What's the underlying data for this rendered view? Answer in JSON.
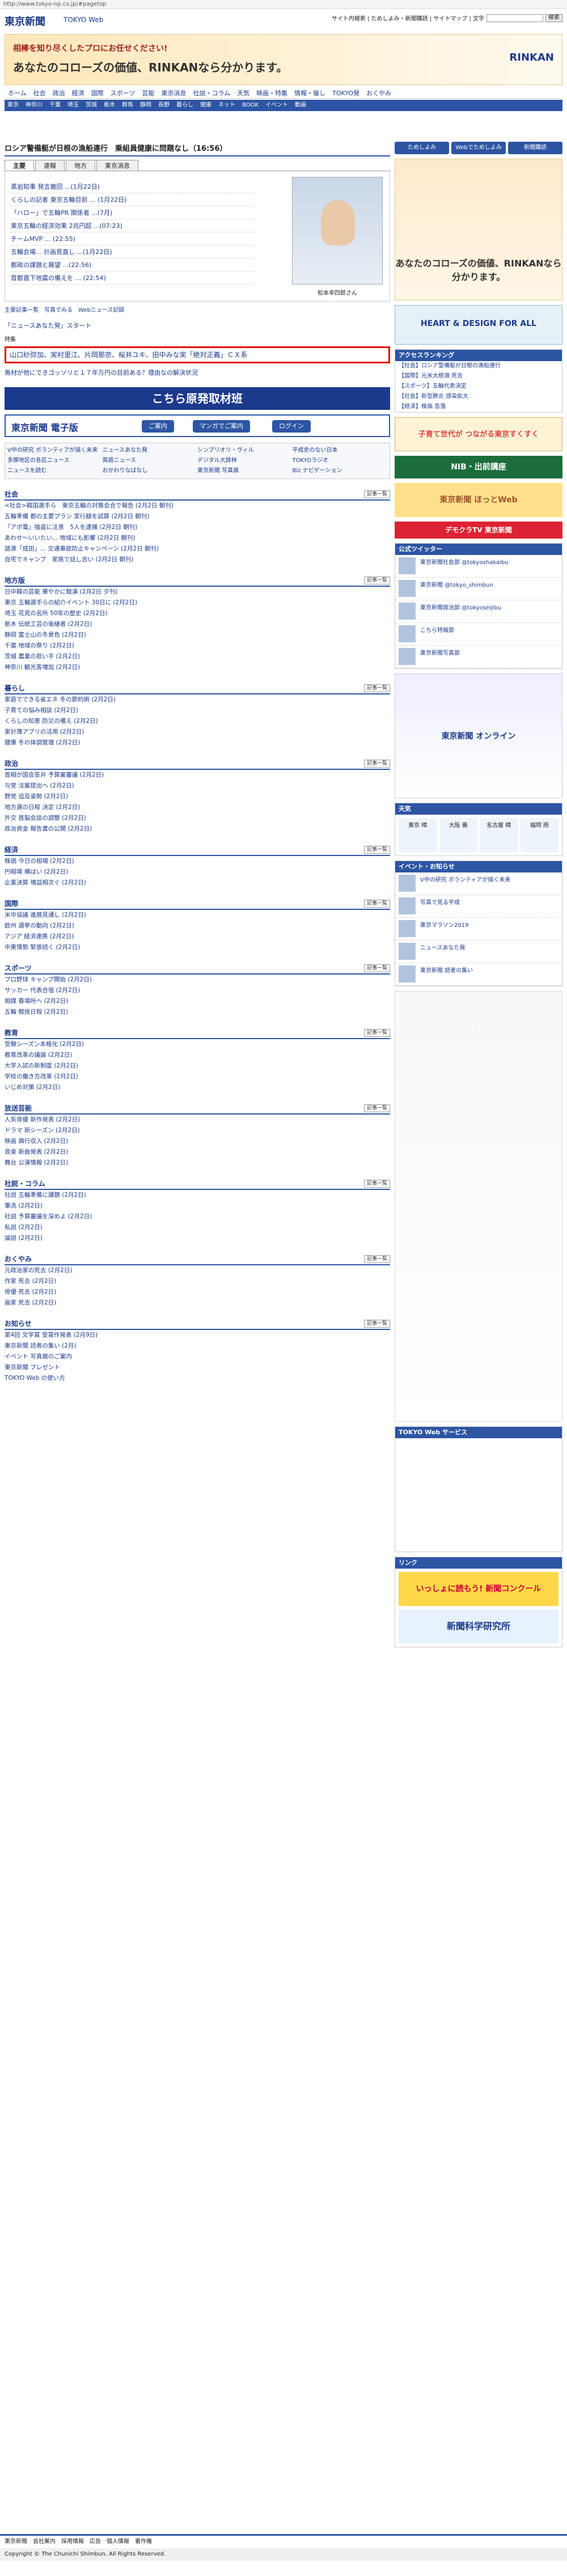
{
  "url": "http://www.tokyo-np.co.jp/#pagetop",
  "logo": {
    "name": "東京新聞",
    "sub": "TOKYO Web"
  },
  "util": {
    "links": "サイト内検索 | ためしよみ・新聞購読 | サイトマップ | 文字",
    "search_btn": "検索"
  },
  "banner_top": {
    "line1": "相棒を知り尽くしたプロにお任せください!",
    "line2": "あなたのコローズの価値、RINKANなら分かります。",
    "brand": "RINKAN"
  },
  "nav1": [
    "ホーム",
    "社会",
    "政治",
    "経済",
    "国際",
    "スポーツ",
    "芸能",
    "東京消息",
    "社説・コラム",
    "天気",
    "映画・特集",
    "情報・催し",
    "TOKYO発",
    "おくやみ"
  ],
  "nav2": [
    "東京",
    "神奈川",
    "千葉",
    "埼玉",
    "茨城",
    "栃木",
    "群馬",
    "静岡",
    "長野",
    "暮らし",
    "健康",
    "ネット",
    "BOOK",
    "イベント",
    "動画"
  ],
  "headline": "ロシア警備艇が日根の漁船連行　乗組員健康に問題なし（16:56）",
  "tabs": [
    "主要",
    "速報",
    "地方",
    "東京消息"
  ],
  "toplist": [
    "黒岩知事 発言撤回 ...(1月22日)",
    "くらしの記者 東京五輪目前 ... (1月22日)",
    "「ハロー」で五輪PR 関係者 ...(7月)",
    "東京五輪の経済効果 2兆円超 ...(07:23)",
    "チームMVP ... (22:55)",
    "五輪会場... 計画見直し ...(1月22日)",
    "都政の課題と展望 ...(22:56)",
    "首都直下地震の備えを ... (22:54)"
  ],
  "photo_caption": "松本幸四郎さん",
  "morelinks": "主要記事一覧　写真でみる　Webニュース記録",
  "recent_label": "特集",
  "sublist": [
    "「ニュースあなた発」スタート"
  ],
  "red_item": "山口紗弥加、実村里江、片岡那奈、桜井ユキ、田中みな実「絶対正義」ＣＸ系",
  "sublist2": [
    "角材が他にできゴッソリと１７年万円の目前ある？理由なの解決状況"
  ],
  "ad_origin": "こちら原発取材班",
  "ad_digital": {
    "title": "東京新聞 電子版",
    "b1": "ご案内",
    "b2": "マンガでご案内",
    "b3": "ログイン"
  },
  "quick": [
    "V中の研究 ボランティアが描く未来",
    "ニュースあなた発",
    "シンプリオリ・ヴィル",
    "平成史のない日本",
    "多摩地区の各区ニュース",
    "英語ニュース",
    "デジタル大辞林",
    "TOKYOラジオ",
    "ニュースを読む",
    "おかわりなばなし",
    "東京新聞 写真展",
    "Biz ナビゲーション"
  ],
  "sections": [
    {
      "title": "社会",
      "items": [
        "<社会>韓国選手ら　東京五輪の対策会合で報告 (2月2日 朝刊)",
        "五輪準備 都の主要プラン 実行額を試算 (2月2日 朝刊)",
        "「アポ電」強盗に注意　5人を逮捕 (2月2日 朝刊)",
        "あわせ〜いいたい... 地域にも影響 (2月2日 朝刊)",
        "語源「成田」... 交通事故防止キャンペーン (2月2日 朝刊)",
        "自宅でキャンプ　家族で話し合い (2月2日 朝刊)"
      ]
    },
    {
      "title": "地方版",
      "items": [
        "日中韓の芸能 華やかに競演 (2月2日 夕刊)",
        "東京 五輪選手らの紹介イベント 30日に (2月2日)",
        "埼玉 花見の名所 50年の歴史 (2月2日)",
        "栃木 伝統工芸の後継者 (2月2日)",
        "静岡 富士山の冬景色 (2月2日)",
        "千葉 地域の祭り (2月2日)",
        "茨城 農業の担い手 (2月2日)",
        "神奈川 観光客増加 (2月2日)"
      ]
    },
    {
      "title": "暮らし",
      "items": [
        "家庭でできる省エネ 冬の節約術 (2月2日)",
        "子育ての悩み相談 (2月2日)",
        "くらしの知恵 防災の備え (2月2日)",
        "家計簿アプリの活用 (2月2日)",
        "健康 冬の体調管理 (2月2日)"
      ]
    },
    {
      "title": "政治",
      "items": [
        "首相が国会答弁 予算案審議 (2月2日)",
        "与党 法案提出へ (2月2日)",
        "野党 追及姿勢 (2月2日)",
        "地方選の日程 決定 (2月2日)",
        "外交 首脳会談の調整 (2月2日)",
        "政治資金 報告書の公開 (2月2日)"
      ]
    },
    {
      "title": "経済",
      "items": [
        "株価 今日の相場 (2月2日)",
        "円相場 横ばい (2月2日)",
        "企業決算 増益相次ぐ (2月2日)"
      ]
    },
    {
      "title": "国際",
      "items": [
        "米中協議 進展見通し (2月2日)",
        "欧州 選挙の動向 (2月2日)",
        "アジア 経済連携 (2月2日)",
        "中東情勢 緊張続く (2月2日)"
      ]
    },
    {
      "title": "スポーツ",
      "items": [
        "プロ野球 キャンプ開始 (2月2日)",
        "サッカー 代表合宿 (2月2日)",
        "相撲 春場所へ (2月2日)",
        "五輪 競技日程 (2月2日)"
      ]
    },
    {
      "title": "教育",
      "items": [
        "受験シーズン本格化 (2月2日)",
        "教育改革の議論 (2月2日)",
        "大学入試の新制度 (2月2日)",
        "学校の働き方改革 (2月2日)",
        "いじめ対策 (2月2日)"
      ]
    },
    {
      "title": "放送芸能",
      "items": [
        "人気俳優 新作発表 (2月2日)",
        "ドラマ 新シーズン (2月2日)",
        "映画 興行収入 (2月2日)",
        "音楽 新曲発表 (2月2日)",
        "舞台 公演情報 (2月2日)"
      ]
    },
    {
      "title": "社説・コラム",
      "items": [
        "社説 五輪準備に課題 (2月2日)",
        "筆洗 (2月2日)",
        "社説 予算審議を深めよ (2月2日)",
        "私説 (2月2日)",
        "論説 (2月2日)"
      ]
    },
    {
      "title": "おくやみ",
      "items": [
        "元政治家の死去 (2月2日)",
        "作家 死去 (2月2日)",
        "俳優 死去 (2月2日)",
        "画家 死去 (2月2日)"
      ]
    },
    {
      "title": "お知らせ",
      "items": [
        "第4回 文学賞 受賞作発表 (2月9日)",
        "東京新聞 読者の集い (2月)",
        "イベント 写真展のご案内",
        "東京新聞 プレゼント",
        "TOKYO Web の使い方"
      ]
    }
  ],
  "side": {
    "buttons": [
      "ためしよみ",
      "Webでためしよみ",
      "新聞購読"
    ],
    "ad_heart": "HEART & DESIGN FOR ALL",
    "access_title": "アクセスランキング",
    "access": [
      "【社会】ロシア警備艇が日根の漁船連行",
      "【国際】元米大統領 死去",
      "【スポーツ】五輪代表決定",
      "【社会】新型肺炎 感染拡大",
      "【経済】株価 急落"
    ],
    "sukusuku": "子育て世代が つながる東京すくすく",
    "nib": "NIB・出前講座",
    "hotto": "東京新聞 ほっとWeb",
    "digi": "デモクラTV 東京新聞",
    "twitter_title": "公式ツイッター",
    "tweets": [
      "東京新聞社会部 @tokyoshakaibu",
      "東京新聞 @tokyo_shimbun",
      "東京新聞政治部 @tokyoseijibu",
      "こちら特報部",
      "東京新聞写真部"
    ],
    "ads_mid": "東京新聞 オンライン",
    "weather_title": "天気",
    "weather": [
      "東京 晴",
      "大阪 曇",
      "名古屋 晴",
      "福岡 雨"
    ],
    "event_title": "イベント・お知らせ",
    "events": [
      "V中の研究 ボランティアが描く未来",
      "写真で見る平成",
      "東京マラソン2019",
      "ニュースあなた発",
      "東京新聞 読者の集い"
    ],
    "service_title": "TOKYO Web サービス",
    "link_title": "リンク",
    "concours": "いっしょに読もう! 新聞コンクール",
    "science": "新聞科学研究所"
  },
  "footer": {
    "links": [
      "東京新聞",
      "会社案内",
      "採用情報",
      "広告",
      "個人情報",
      "著作権"
    ],
    "copyright": "Copyright © The Chunichi Shimbun, All Rights Reserved."
  }
}
